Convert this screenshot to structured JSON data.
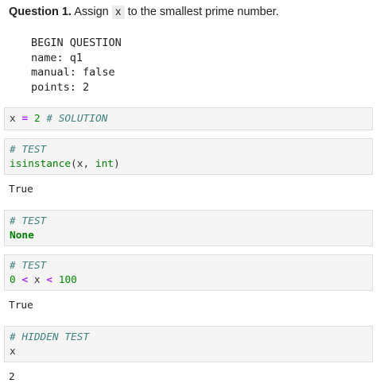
{
  "question": {
    "number": "Question 1.",
    "text_before": "Assign",
    "code_var": "x",
    "text_after": "to the smallest prime number."
  },
  "metadata_block": {
    "lines": [
      "BEGIN QUESTION",
      "name: q1",
      "manual: false",
      "points: 2"
    ]
  },
  "cells": [
    {
      "kind": "solution",
      "var": "x",
      "op": "=",
      "value": "2",
      "comment": "# SOLUTION"
    },
    {
      "kind": "test",
      "comment": "# TEST",
      "fn": "isinstance",
      "open": "(x, ",
      "type": "int",
      "close": ")",
      "output": "True"
    },
    {
      "kind": "test",
      "comment": "# TEST",
      "keyword": "None"
    },
    {
      "kind": "test",
      "comment": "# TEST",
      "lower": "0",
      "op1": "<",
      "var": "x",
      "op2": "<",
      "upper": "100",
      "output": "True"
    },
    {
      "kind": "hidden_test",
      "comment": "# HIDDEN TEST",
      "expr": "x",
      "output": "2"
    }
  ]
}
